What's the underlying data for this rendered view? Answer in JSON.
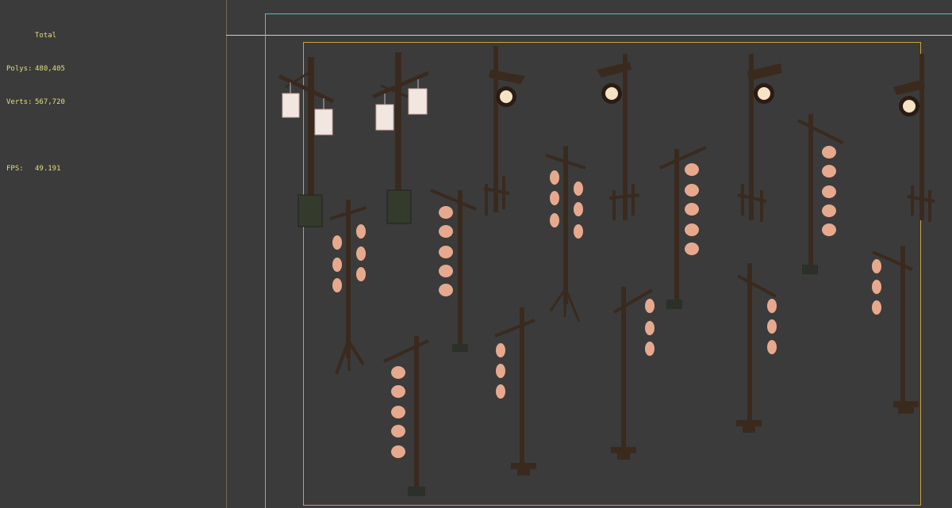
{
  "stats": {
    "title": "Total",
    "polys_label": "Polys:",
    "polys_value": "480,405",
    "verts_label": "Verts:",
    "verts_value": "567,720",
    "fps_label": "FPS:",
    "fps_value": "49.191"
  },
  "colors": {
    "background": "#3b3b3b",
    "stats_text": "#e6de7a",
    "safe_frame_outer": "#6a6a6a",
    "safe_frame_cyan": "#4fc2c2",
    "safe_frame_gold": "#c9a23a",
    "horizon_line": "#cfcfcf",
    "pole_wood": "#3a2a1e",
    "lantern_red": "#e7a98e",
    "lantern_white": "#f2e7e0",
    "lamp_glow": "#f6e3c5"
  }
}
